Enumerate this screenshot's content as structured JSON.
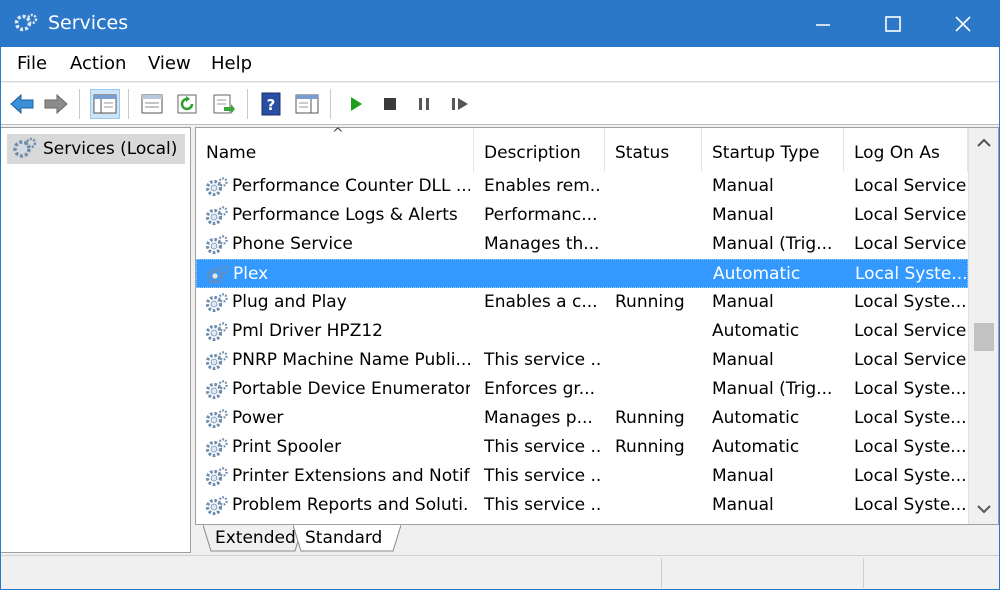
{
  "window": {
    "title": "Services"
  },
  "menu": [
    "File",
    "Action",
    "View",
    "Help"
  ],
  "toolbar": [
    "back",
    "forward",
    "show-hide-console-tree",
    "properties",
    "refresh",
    "export-list",
    "help",
    "show-action-pane",
    "start-service",
    "stop-service",
    "pause-service",
    "restart-service"
  ],
  "tree": {
    "root_label": "Services (Local)"
  },
  "list": {
    "columns": [
      "Name",
      "Description",
      "Status",
      "Startup Type",
      "Log On As"
    ],
    "rows": [
      {
        "name": "Performance Counter DLL ...",
        "description": "Enables rem...",
        "status": "",
        "startup": "Manual",
        "logon": "Local Service"
      },
      {
        "name": "Performance Logs & Alerts",
        "description": "Performanc...",
        "status": "",
        "startup": "Manual",
        "logon": "Local Service"
      },
      {
        "name": "Phone Service",
        "description": "Manages th...",
        "status": "",
        "startup": "Manual (Trig...",
        "logon": "Local Service"
      },
      {
        "name": "Plex",
        "description": "",
        "status": "",
        "startup": "Automatic",
        "logon": "Local Syste...",
        "selected": true
      },
      {
        "name": "Plug and Play",
        "description": "Enables a c...",
        "status": "Running",
        "startup": "Manual",
        "logon": "Local Syste..."
      },
      {
        "name": "Pml Driver HPZ12",
        "description": "",
        "status": "",
        "startup": "Automatic",
        "logon": "Local Service"
      },
      {
        "name": "PNRP Machine Name Publi...",
        "description": "This service ...",
        "status": "",
        "startup": "Manual",
        "logon": "Local Service"
      },
      {
        "name": "Portable Device Enumerator...",
        "description": "Enforces gr...",
        "status": "",
        "startup": "Manual (Trig...",
        "logon": "Local Syste..."
      },
      {
        "name": "Power",
        "description": "Manages p...",
        "status": "Running",
        "startup": "Automatic",
        "logon": "Local Syste..."
      },
      {
        "name": "Print Spooler",
        "description": "This service ...",
        "status": "Running",
        "startup": "Automatic",
        "logon": "Local Syste..."
      },
      {
        "name": "Printer Extensions and Notif...",
        "description": "This service ...",
        "status": "",
        "startup": "Manual",
        "logon": "Local Syste..."
      },
      {
        "name": "Problem Reports and Soluti...",
        "description": "This service ...",
        "status": "",
        "startup": "Manual",
        "logon": "Local Syste..."
      }
    ]
  },
  "tabs": [
    "Extended",
    "Standard"
  ],
  "colors": {
    "titlebar": "#2b78c9",
    "selection": "#3399ff",
    "play_green": "#1e9e1e",
    "nav_blue": "#3b8fd6"
  }
}
